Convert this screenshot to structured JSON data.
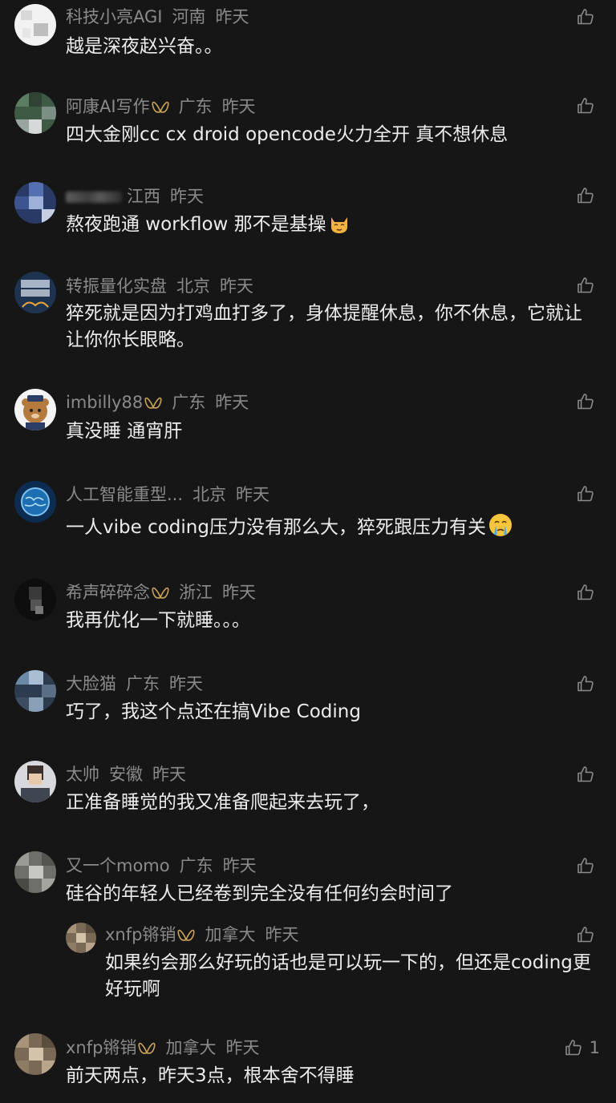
{
  "location_time_sep": " ",
  "comments": [
    {
      "name": "科技小亮AGI",
      "region": "河南",
      "time": "昨天",
      "text": "越是深夜赵兴奋。。"
    },
    {
      "name": "阿康AI写作",
      "region": "广东",
      "time": "昨天",
      "text": "四大金刚cc cx droid opencode火力全开 真不想休息"
    },
    {
      "name": "",
      "region": "江西",
      "time": "昨天",
      "text": "熬夜跑通 workflow 那不是基操"
    },
    {
      "name": "转振量化实盘",
      "region": "北京",
      "time": "昨天",
      "text": "猝死就是因为打鸡血打多了，身体提醒休息，你不休息，它就让让你你长眼略。"
    },
    {
      "name": "imbilly88",
      "region": "广东",
      "time": "昨天",
      "text": "真没睡 通宵肝"
    },
    {
      "name": "人工智能重型...",
      "region": "北京",
      "time": "昨天",
      "text": "一人vibe coding压力没有那么大，猝死跟压力有关"
    },
    {
      "name": "希声碎碎念",
      "region": "浙江",
      "time": "昨天",
      "text": "我再优化一下就睡。。。"
    },
    {
      "name": "大脸猫",
      "region": "广东",
      "time": "昨天",
      "text": "巧了，我这个点还在搞Vibe Coding"
    },
    {
      "name": "太帅",
      "region": "安徽",
      "time": "昨天",
      "text": "正准备睡觉的我又准备爬起来去玩了，"
    },
    {
      "name": "又一个momo",
      "region": "广东",
      "time": "昨天",
      "text": "硅谷的年轻人已经卷到完全没有任何约会时间了"
    },
    {
      "name": "xnfp锵销",
      "region": "加拿大",
      "time": "昨天",
      "text": "如果约会那么好玩的话也是可以玩一下的，但还是coding更好玩啊"
    },
    {
      "name": "xnfp锵销",
      "region": "加拿大",
      "time": "昨天",
      "text": "前天两点，昨天3点，根本舍不得睡",
      "likes": "1"
    }
  ],
  "icons": {
    "like": "thumbs-up-icon",
    "badge": "butterfly-badge-icon",
    "emoji_cat": "smirk-cat-emoji",
    "emoji_cry": "crying-face-emoji"
  },
  "colors": {
    "background": "#161616",
    "meta_text": "#8a8a8a",
    "body_text": "#ececec",
    "badge": "#c9a25a"
  }
}
